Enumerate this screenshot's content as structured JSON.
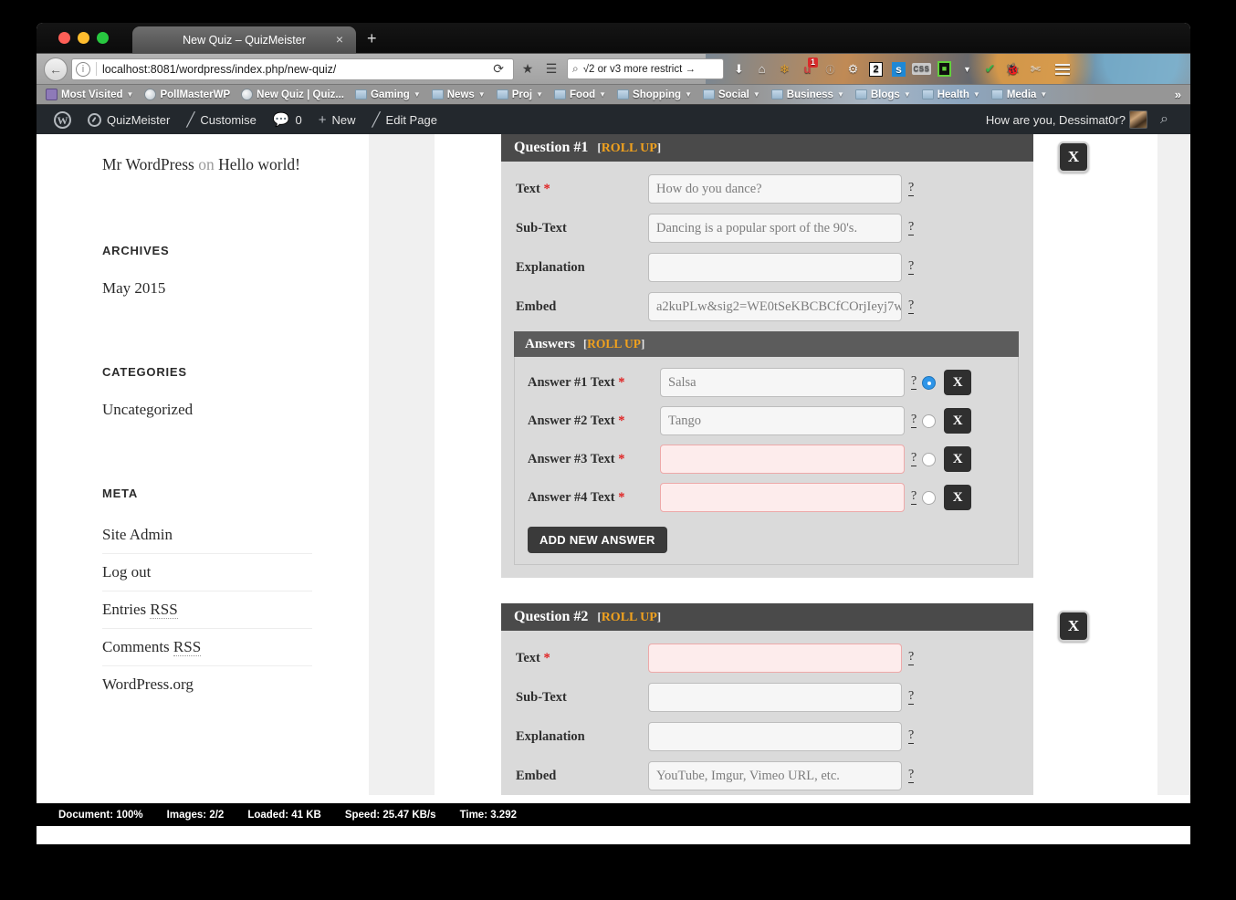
{
  "window": {
    "traffic_lights": [
      "close",
      "minimize",
      "zoom"
    ],
    "tab_title": "New Quiz – QuizMeister",
    "tab_close": "×",
    "new_tab": "+"
  },
  "navbar": {
    "back_icon": "←",
    "info_icon": "i",
    "url": "localhost:8081/wordpress/index.php/new-quiz/",
    "reload_icon": "⟳",
    "bookmark_star_icon": "★",
    "reader_icon": "☰",
    "search_text": "√2 or v3 more restrict →",
    "search_mag_icon": "⌕",
    "extensions": [
      {
        "name": "downloads-icon",
        "glyph": "⬇"
      },
      {
        "name": "home-icon",
        "glyph": "⌂"
      },
      {
        "name": "autumn-leaf-icon",
        "glyph": "🍁"
      },
      {
        "name": "ublock-icon",
        "glyph": "u",
        "badge": "1"
      },
      {
        "name": "lastpass-icon",
        "glyph": "ⓤ"
      },
      {
        "name": "stumble-icon",
        "glyph": "⚙"
      },
      {
        "name": "tab-count-icon",
        "glyph": "2"
      },
      {
        "name": "evernote-icon",
        "glyph": "s"
      },
      {
        "name": "css-toggle-icon",
        "glyph": "CSS"
      },
      {
        "name": "colorzilla-icon",
        "glyph": "█"
      },
      {
        "name": "shield-icon",
        "glyph": "✔"
      },
      {
        "name": "firebug-icon",
        "glyph": "🐞"
      },
      {
        "name": "screenshot-scissors-icon",
        "glyph": "✂"
      }
    ],
    "menu_icon": "hamburger"
  },
  "bookmarks": {
    "items": [
      {
        "label": "Most Visited",
        "icon": "most-visited-icon",
        "caret": true
      },
      {
        "label": "PollMasterWP",
        "icon": "globe-icon",
        "caret": false
      },
      {
        "label": "New Quiz | Quiz...",
        "icon": "globe-icon",
        "caret": false
      },
      {
        "label": "Gaming",
        "icon": "folder-icon",
        "caret": true
      },
      {
        "label": "News",
        "icon": "folder-icon",
        "caret": true
      },
      {
        "label": "Proj",
        "icon": "folder-icon",
        "caret": true
      },
      {
        "label": "Food",
        "icon": "folder-icon",
        "caret": true
      },
      {
        "label": "Shopping",
        "icon": "folder-icon",
        "caret": true
      },
      {
        "label": "Social",
        "icon": "folder-icon",
        "caret": true
      },
      {
        "label": "Business",
        "icon": "folder-icon",
        "caret": true
      },
      {
        "label": "Blogs",
        "icon": "folder-icon",
        "caret": true
      },
      {
        "label": "Health",
        "icon": "folder-icon",
        "caret": true
      },
      {
        "label": "Media",
        "icon": "folder-icon",
        "caret": true
      }
    ],
    "overflow": "»"
  },
  "adminbar": {
    "wp_logo": "W",
    "site_name": "QuizMeister",
    "customise": "Customise",
    "comments_count": "0",
    "new": "New",
    "edit_page": "Edit Page",
    "greeting": "How are you, Dessimat0r?",
    "search_icon": "⌕"
  },
  "sidebar": {
    "recent_comment": {
      "author": "Mr WordPress",
      "on": "on",
      "post": "Hello world!"
    },
    "archives": {
      "title": "ARCHIVES",
      "items": [
        "May 2015"
      ]
    },
    "categories": {
      "title": "CATEGORIES",
      "items": [
        "Uncategorized"
      ]
    },
    "meta": {
      "title": "META",
      "items": [
        {
          "label": "Site Admin",
          "abbr": ""
        },
        {
          "label": "Log out",
          "abbr": ""
        },
        {
          "label": "Entries ",
          "abbr": "RSS"
        },
        {
          "label": "Comments ",
          "abbr": "RSS"
        },
        {
          "label": "WordPress.org",
          "abbr": ""
        }
      ]
    }
  },
  "quiz": {
    "rollup_open": "[",
    "rollup_label": "ROLL UP",
    "rollup_close": "]",
    "close_label": "X",
    "help_glyph": "?",
    "required_mark": "*",
    "questions": [
      {
        "title": "Question #1",
        "fields": [
          {
            "label": "Text",
            "required": true,
            "value": "How do you dance?",
            "placeholder": "",
            "invalid": false
          },
          {
            "label": "Sub-Text",
            "required": false,
            "value": "Dancing is a popular sport of the 90's.",
            "placeholder": "",
            "invalid": false
          },
          {
            "label": "Explanation",
            "required": false,
            "value": "",
            "placeholder": "",
            "invalid": false
          },
          {
            "label": "Embed",
            "required": false,
            "value": "a2kuPLw&sig2=WE0tSeKBCBCfCOrjIeyj7w",
            "placeholder": "",
            "invalid": false
          }
        ],
        "answers": {
          "title": "Answers",
          "add_button": "ADD NEW ANSWER",
          "items": [
            {
              "label": "Answer #1 Text",
              "required": true,
              "value": "Salsa",
              "invalid": false,
              "correct": true
            },
            {
              "label": "Answer #2 Text",
              "required": true,
              "value": "Tango",
              "invalid": false,
              "correct": false
            },
            {
              "label": "Answer #3 Text",
              "required": true,
              "value": "",
              "invalid": true,
              "correct": false
            },
            {
              "label": "Answer #4 Text",
              "required": true,
              "value": "",
              "invalid": true,
              "correct": false
            }
          ]
        }
      },
      {
        "title": "Question #2",
        "fields": [
          {
            "label": "Text",
            "required": true,
            "value": "",
            "placeholder": "",
            "invalid": true
          },
          {
            "label": "Sub-Text",
            "required": false,
            "value": "",
            "placeholder": "",
            "invalid": false
          },
          {
            "label": "Explanation",
            "required": false,
            "value": "",
            "placeholder": "",
            "invalid": false
          },
          {
            "label": "Embed",
            "required": false,
            "value": "YouTube, Imgur, Vimeo URL, etc.",
            "placeholder": "YouTube, Imgur, Vimeo URL, etc.",
            "invalid": false
          }
        ],
        "answers": null
      }
    ]
  },
  "statusbar": {
    "document": "Document: 100%",
    "images": "Images: 2/2",
    "loaded": "Loaded: 41 KB",
    "speed": "Speed: 25.47 KB/s",
    "time": "Time: 3.292"
  },
  "colors": {
    "accent_orange": "#f0a11e",
    "admin_bar": "#23282d",
    "panel_header": "#4a4a4a",
    "panel_body": "#dadada",
    "radio_selected": "#2e95e8",
    "invalid_field": "#fdecec",
    "required_star": "#e02020"
  }
}
